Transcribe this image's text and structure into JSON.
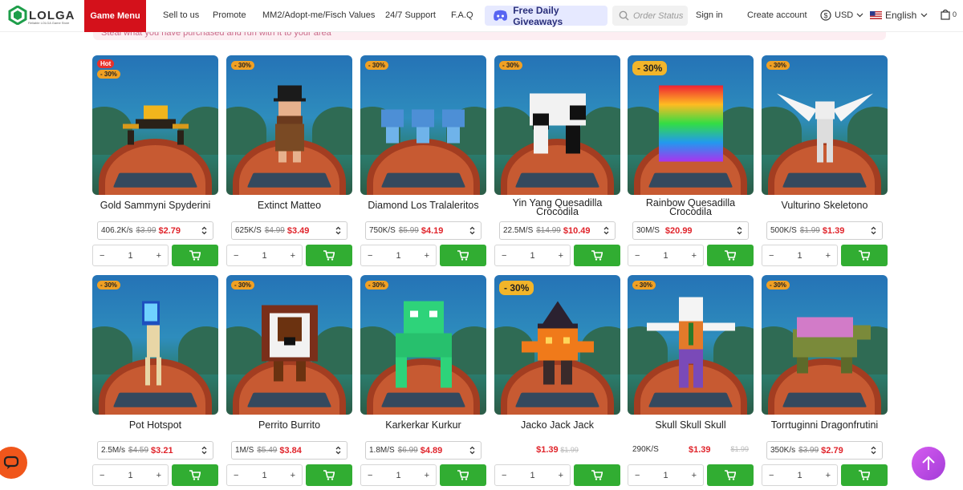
{
  "header": {
    "logo_text": "LOLGA",
    "logo_subtext": "Reliable LOLGA Game Store",
    "game_menu": "Game Menu",
    "nav": [
      "Sell to us",
      "Promote",
      "MM2/Adopt-me/Fisch Values",
      "24/7 Support",
      "F.A.Q"
    ],
    "giveaway": "Free Daily Giveaways",
    "order_status_placeholder": "Order Status",
    "sign_in": "Sign in",
    "create_account": "Create account",
    "currency": "USD",
    "language": "English",
    "cart_count": "0"
  },
  "notice": "Steal what you have purchased and run with it to your area",
  "products": [
    {
      "name": "Gold Sammyni Spyderini",
      "badges": [
        "Hot",
        "- 30%"
      ],
      "rate": "406.2K/s",
      "old": "$3.99",
      "new": "$2.79",
      "qty": "1",
      "variant": "select"
    },
    {
      "name": "Extinct Matteo",
      "badges": [
        "- 30%"
      ],
      "rate": "625K/S",
      "old": "$4.99",
      "new": "$3.49",
      "qty": "1",
      "variant": "select"
    },
    {
      "name": "Diamond Los Tralaleritos",
      "badges": [
        "- 30%"
      ],
      "rate": "750K/S",
      "old": "$5.99",
      "new": "$4.19",
      "qty": "1",
      "variant": "select"
    },
    {
      "name": "Yin Yang Quesadilla Crocodila",
      "badges": [
        "- 30%"
      ],
      "rate": "22.5M/S",
      "old": "$14.99",
      "new": "$10.49",
      "qty": "1",
      "variant": "select"
    },
    {
      "name": "Rainbow Quesadilla Crocodila",
      "badges": [
        "- 30%"
      ],
      "rate": "30M/S",
      "old": "",
      "new": "$20.99",
      "qty": "1",
      "variant": "select"
    },
    {
      "name": "Vulturino Skeletono",
      "badges": [
        "- 30%"
      ],
      "rate": "500K/S",
      "old": "$1.99",
      "new": "$1.39",
      "qty": "1",
      "variant": "select"
    },
    {
      "name": "Pot Hotspot",
      "badges": [
        "- 30%"
      ],
      "rate": "2.5M/s",
      "old": "$4.59",
      "new": "$3.21",
      "qty": "1",
      "variant": "select"
    },
    {
      "name": "Perrito Burrito",
      "badges": [
        "- 30%"
      ],
      "rate": "1M/S",
      "old": "$5.49",
      "new": "$3.84",
      "qty": "1",
      "variant": "select"
    },
    {
      "name": "Karkerkar Kurkur",
      "badges": [
        "- 30%"
      ],
      "rate": "1.8M/S",
      "old": "$6.99",
      "new": "$4.89",
      "qty": "1",
      "variant": "select"
    },
    {
      "name": "Jacko Jack Jack",
      "badges": [
        "- 30%"
      ],
      "rate": "",
      "old": "$1.99",
      "new": "$1.39",
      "qty": "1",
      "variant": "plain"
    },
    {
      "name": "Skull Skull Skull",
      "badges": [
        "- 30%"
      ],
      "rate": "290K/S",
      "old": "$1.99",
      "new": "$1.39",
      "qty": "1",
      "variant": "plain-rate"
    },
    {
      "name": "Torrtuginni Dragonfrutini",
      "badges": [
        "- 30%"
      ],
      "rate": "350K/s",
      "old": "$3.99",
      "new": "$2.79",
      "qty": "1",
      "variant": "select"
    }
  ],
  "colors": {
    "brand_red": "#d4111b",
    "cart_green": "#31ad32",
    "price_red": "#e0242b",
    "badge_orange": "#f0a024"
  },
  "icons": [
    "discord-icon",
    "search-icon",
    "dollar-icon",
    "us-flag-icon",
    "bag-icon",
    "cart-icon",
    "chat-icon",
    "arrow-up-icon"
  ]
}
